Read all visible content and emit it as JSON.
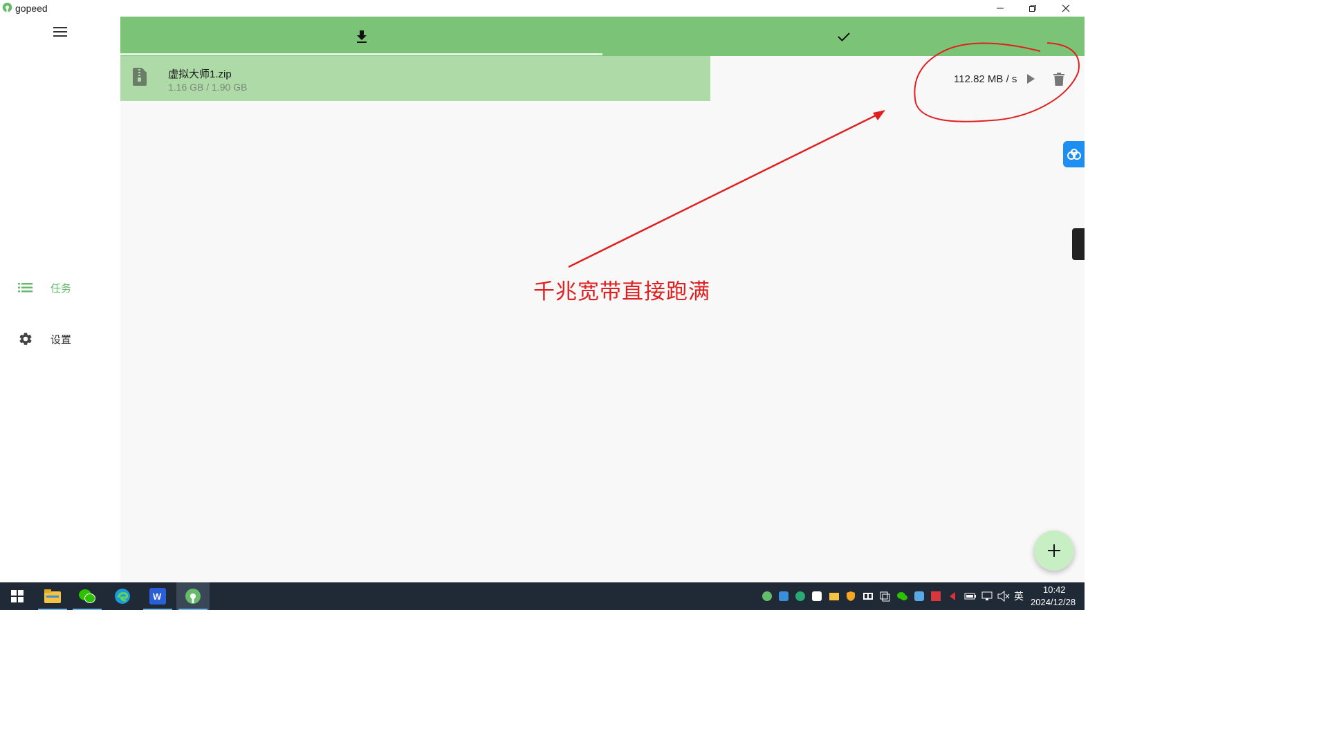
{
  "window": {
    "title": "gopeed"
  },
  "sidebar": {
    "items": [
      {
        "label": "任务",
        "icon": "list-icon",
        "active": true
      },
      {
        "label": "设置",
        "icon": "gear-icon",
        "active": false
      }
    ]
  },
  "tabs": [
    {
      "icon": "download-icon",
      "active": true
    },
    {
      "icon": "check-icon",
      "active": false
    }
  ],
  "task": {
    "file_name": "虚拟大师1.zip",
    "progress_text": "1.16 GB / 1.90 GB",
    "speed": "112.82 MB / s",
    "file_icon": "zip-file-icon"
  },
  "annotation": {
    "text": "千兆宽带直接跑满",
    "color": "#e02020"
  },
  "colors": {
    "accent": "#7bc477",
    "task_row_bg": "#aedaa8",
    "fab_bg": "#c8efc4",
    "active_nav": "#66bb6a"
  },
  "taskbar": {
    "apps": [
      "windows-start-icon",
      "file-explorer-icon",
      "wechat-icon",
      "edge-icon",
      "word-icon",
      "gopeed-icon"
    ],
    "input_language": "英",
    "time": "10:42",
    "date": "2024/12/28"
  }
}
